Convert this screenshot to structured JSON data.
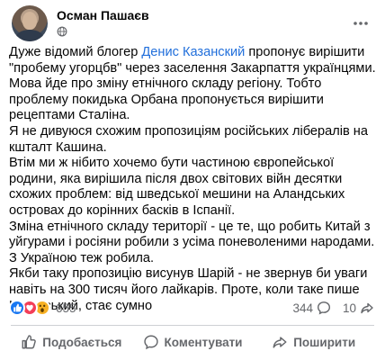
{
  "post": {
    "author": "Осман Пашаєв",
    "more_label": "···",
    "body": {
      "p1_before": "Дуже відомий блогер ",
      "p1_link": "Денис Казанский",
      "p1_after": "  пропонує вирішити \"пробему угорцбв\" через заселення Закарпаття українцями.",
      "p2": "Мова йде про зміну етнічного складу регіону. Тобто проблему покидька Орбана пропонується вирішити рецептами Сталіна.",
      "p3": "Я не дивуюся схожим пропозиціям російських лібералів на кшталт Кашина.",
      "p4": "Втім ми ж нібито хочемо бути частиною європейської родини, яка вирішила після двох світових війн десятки схожих проблем: від шведської мешини на Аландських островах до корінних басків в Іспанії.",
      "p5": "Зміна етнічного складу території - це те, що робить Китай з уйгурами і росіяни робили з усіма поневоленими народами. З Україною теж робила.",
      "p6": "Якби таку пропозицію висунув Шарій - не звернув би уваги навіть на 300 тисяч його лайкарів. Проте, коли таке пише Казанський, стає сумно"
    }
  },
  "reactions": {
    "icons": [
      "like-icon",
      "love-icon",
      "wow-icon"
    ],
    "total": "655",
    "comments": "344",
    "shares": "10"
  },
  "actions": {
    "like": "Подобається",
    "comment": "Коментувати",
    "share": "Поширити"
  },
  "colors": {
    "link": "#216fdb",
    "muted": "#65676b",
    "like": "#1877f2",
    "love": "#f33e58",
    "wow": "#f7b125"
  }
}
